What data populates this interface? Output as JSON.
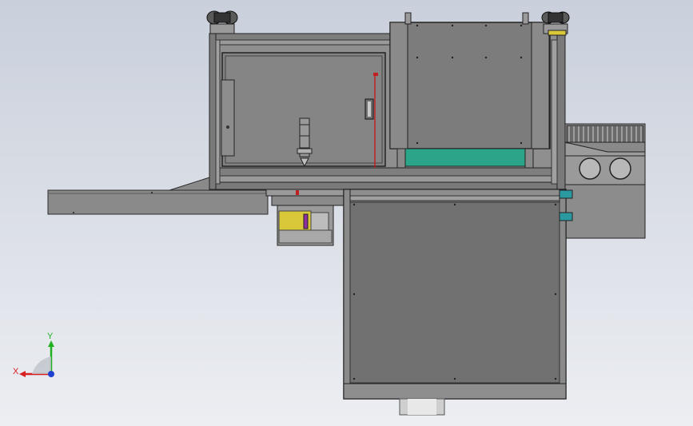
{
  "view": {
    "background_top": "#c9d0dc",
    "background_bottom": "#eceef2"
  },
  "triad": {
    "x_label": "X",
    "y_label": "Y",
    "x_color": "#d82020",
    "y_color": "#20b020",
    "z_color": "#2040d0"
  },
  "colors": {
    "frame": "#8c8c8c",
    "panel": "#7f7f7f",
    "panel_dark": "#6e6e6e",
    "teal": "#2aa58a",
    "yellow": "#d8c83a",
    "red_line": "#c02020",
    "purple": "#9030a0",
    "cyan_clamp": "#2a9aa0"
  }
}
